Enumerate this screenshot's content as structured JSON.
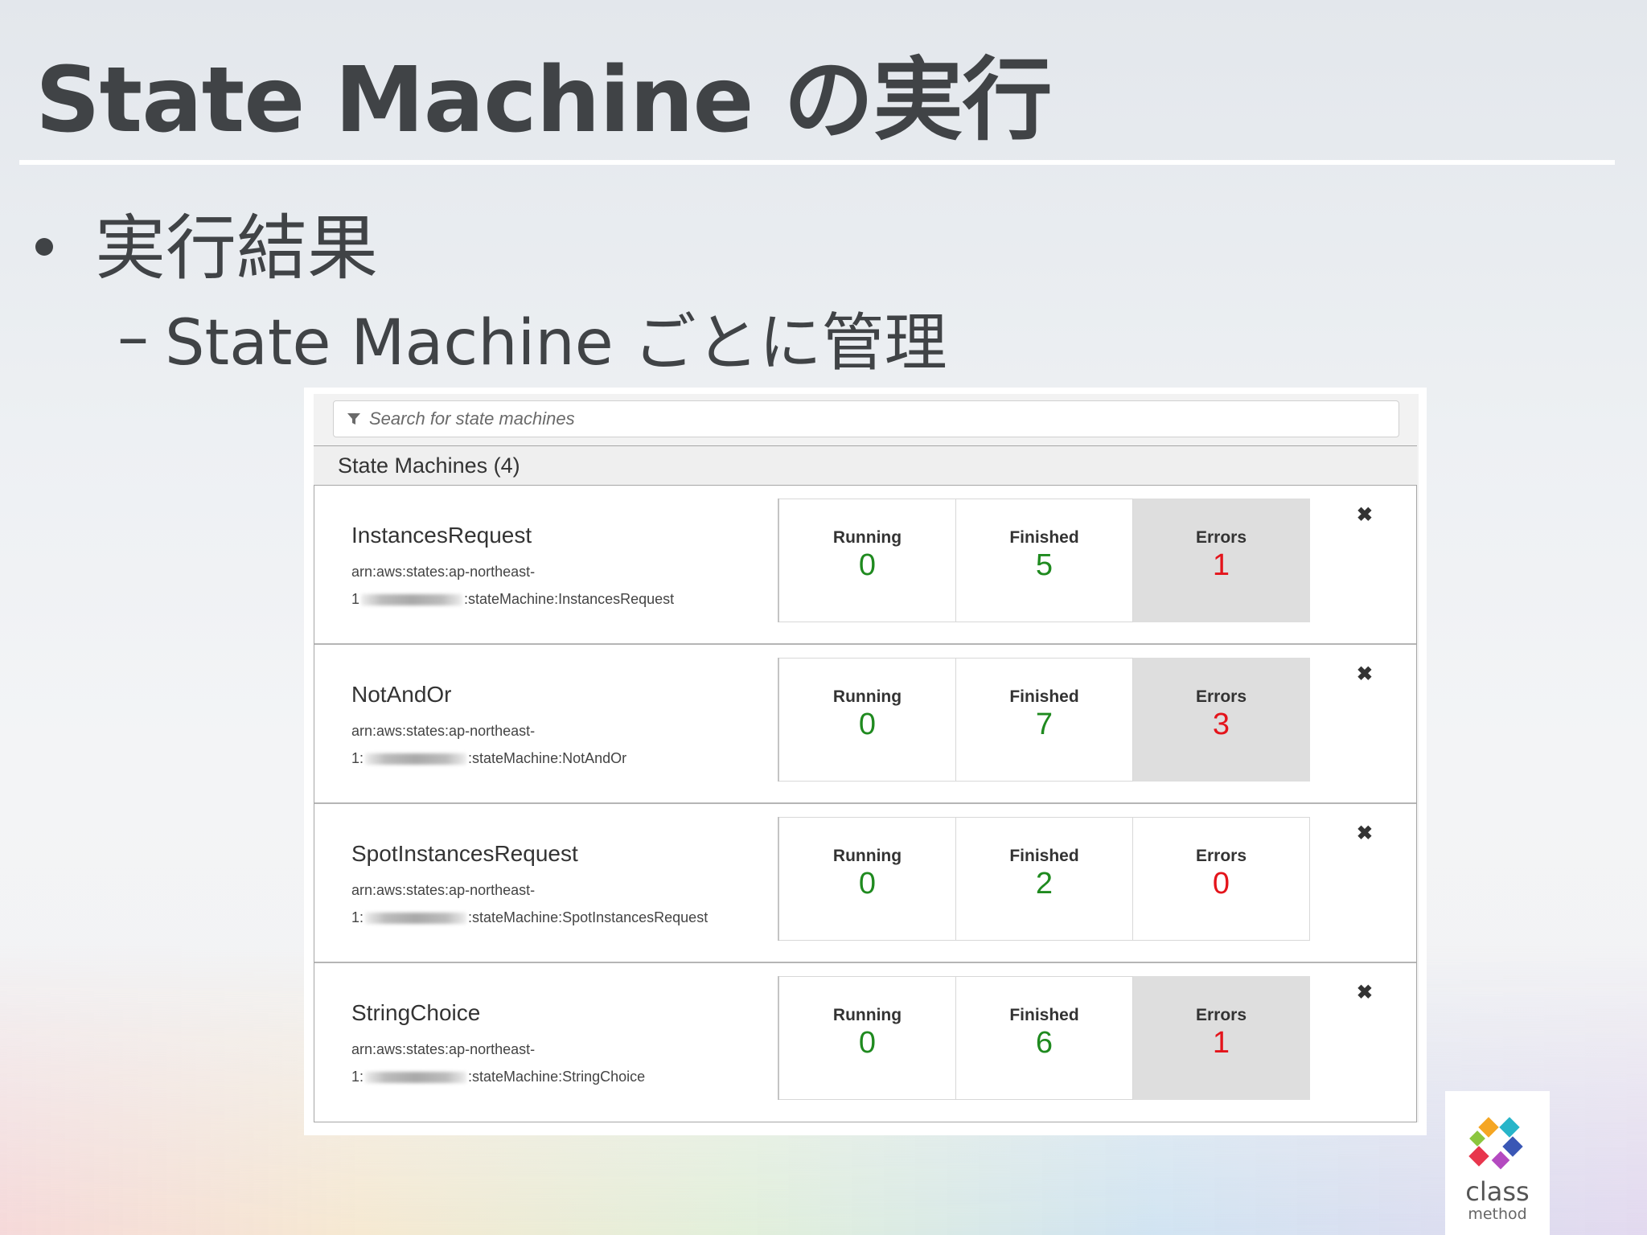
{
  "slide": {
    "title": "State Machine の実行",
    "bullet": "実行結果",
    "sub_bullet_dash": "–",
    "sub_bullet": "State Machine ごとに管理"
  },
  "console": {
    "search": {
      "placeholder": "Search for state machines",
      "value": ""
    },
    "header": "State Machines (4)",
    "state_machines": [
      {
        "name": "InstancesRequest",
        "arn_line1": "arn:aws:states:ap-northeast-",
        "arn_prefix": "1",
        "arn_suffix": ":stateMachine:InstancesRequest",
        "running_label": "Running",
        "running": "0",
        "finished_label": "Finished",
        "finished": "5",
        "errors_label": "Errors",
        "errors": "1",
        "close": "✖"
      },
      {
        "name": "NotAndOr",
        "arn_line1": "arn:aws:states:ap-northeast-",
        "arn_prefix": "1:",
        "arn_suffix": ":stateMachine:NotAndOr",
        "running_label": "Running",
        "running": "0",
        "finished_label": "Finished",
        "finished": "7",
        "errors_label": "Errors",
        "errors": "3",
        "close": "✖"
      },
      {
        "name": "SpotInstancesRequest",
        "arn_line1": "arn:aws:states:ap-northeast-",
        "arn_prefix": "1:",
        "arn_suffix": ":stateMachine:SpotInstancesRequest",
        "running_label": "Running",
        "running": "0",
        "finished_label": "Finished",
        "finished": "2",
        "errors_label": "Errors",
        "errors": "0",
        "close": "✖"
      },
      {
        "name": "StringChoice",
        "arn_line1": "arn:aws:states:ap-northeast-",
        "arn_prefix": "1:",
        "arn_suffix": ":stateMachine:StringChoice",
        "running_label": "Running",
        "running": "0",
        "finished_label": "Finished",
        "finished": "6",
        "errors_label": "Errors",
        "errors": "1",
        "close": "✖"
      }
    ]
  },
  "logo": {
    "line1": "class",
    "line2": "method"
  },
  "colors": {
    "running": "#1f8a1f",
    "finished": "#1f8a1f",
    "errors": "#e4141b",
    "errors_highlight_bg": "#dedede"
  },
  "icons": {
    "search": "filter-icon",
    "remove": "close-icon"
  }
}
